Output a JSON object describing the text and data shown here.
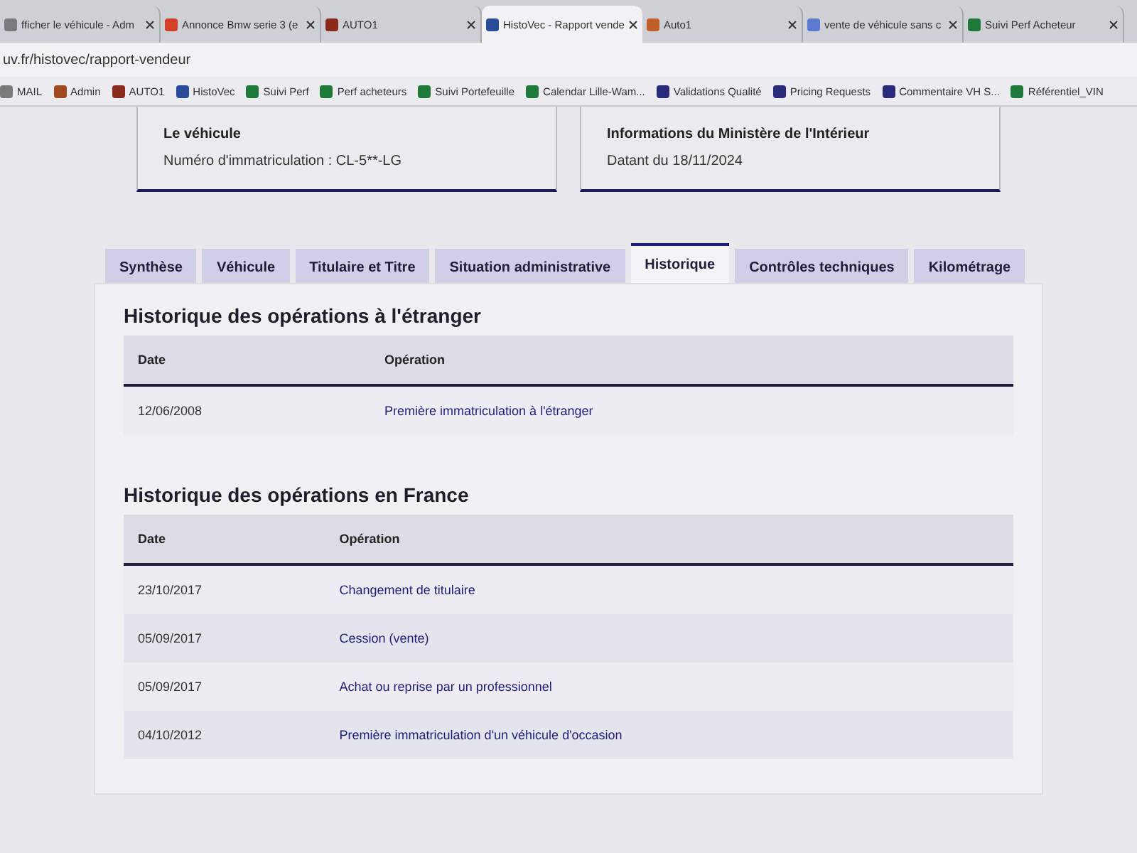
{
  "browser": {
    "tabs": [
      {
        "title": "fficher le véhicule - Adm",
        "selected": false,
        "color": "#7a7a7a"
      },
      {
        "title": "Annonce Bmw serie 3 (e",
        "selected": false,
        "color": "#d2402a"
      },
      {
        "title": "AUTO1",
        "selected": false,
        "color": "#8a2a1a"
      },
      {
        "title": "HistoVec - Rapport vende",
        "selected": true,
        "color": "#2a4a9a"
      },
      {
        "title": "Auto1",
        "selected": false,
        "color": "#c0602a"
      },
      {
        "title": "vente de véhicule sans c",
        "selected": false,
        "color": "#5a7ad0"
      },
      {
        "title": "Suivi Perf Acheteur",
        "selected": false,
        "color": "#1f7a3a"
      }
    ],
    "address": "uv.fr/histovec/rapport-vendeur",
    "bookmarks": [
      {
        "label": "MAIL",
        "color": "#7a7a7a"
      },
      {
        "label": "Admin",
        "color": "#a04a20"
      },
      {
        "label": "AUTO1",
        "color": "#8a2a1a"
      },
      {
        "label": "HistoVec",
        "color": "#2a4a9a"
      },
      {
        "label": "Suivi Perf",
        "color": "#1f7a3a"
      },
      {
        "label": "Perf acheteurs",
        "color": "#1f7a3a"
      },
      {
        "label": "Suivi Portefeuille",
        "color": "#1f7a3a"
      },
      {
        "label": "Calendar Lille-Wam...",
        "color": "#1f7a3a"
      },
      {
        "label": "Validations Qualité",
        "color": "#2a2a7a"
      },
      {
        "label": "Pricing Requests",
        "color": "#2a2a7a"
      },
      {
        "label": "Commentaire VH S...",
        "color": "#2a2a7a"
      },
      {
        "label": "Référentiel_VIN",
        "color": "#1f7a3a"
      }
    ]
  },
  "cards": [
    {
      "title": "Le véhicule",
      "text": "Numéro d'immatriculation : CL-5**-LG"
    },
    {
      "title": "Informations du Ministère de l'Intérieur",
      "text": "Datant du 18/11/2024"
    }
  ],
  "tabs": [
    {
      "label": "Synthèse",
      "selected": false
    },
    {
      "label": "Véhicule",
      "selected": false
    },
    {
      "label": "Titulaire et Titre",
      "selected": false
    },
    {
      "label": "Situation administrative",
      "selected": false
    },
    {
      "label": "Historique",
      "selected": true
    },
    {
      "label": "Contrôles techniques",
      "selected": false
    },
    {
      "label": "Kilométrage",
      "selected": false
    }
  ],
  "sections": [
    {
      "title": "Historique des opérations à l'étranger",
      "columns": [
        "Date",
        "Opération"
      ],
      "rows": [
        {
          "date": "12/06/2008",
          "operation": "Première immatriculation à l'étranger"
        }
      ]
    },
    {
      "title": "Historique des opérations en France",
      "columns": [
        "Date",
        "Opération"
      ],
      "rows": [
        {
          "date": "23/10/2017",
          "operation": "Changement de titulaire"
        },
        {
          "date": "05/09/2017",
          "operation": "Cession (vente)"
        },
        {
          "date": "05/09/2017",
          "operation": "Achat ou reprise par un professionnel"
        },
        {
          "date": "04/10/2012",
          "operation": "Première immatriculation d'un véhicule d'occasion"
        }
      ]
    }
  ]
}
